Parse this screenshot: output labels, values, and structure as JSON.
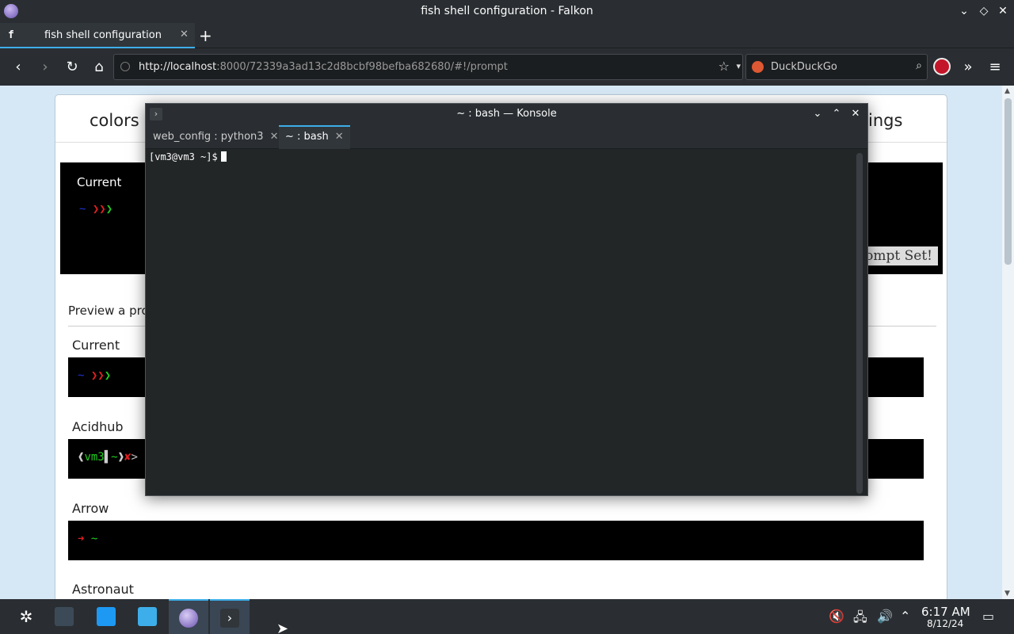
{
  "browser": {
    "window_title": "fish shell configuration - Falkon",
    "tab_favicon": "f",
    "tab_label": "fish shell configuration",
    "url_host": "http://localhost",
    "url_rest": ":8000/72339a3ad13c2d8bcbf98befba682680/#!/prompt",
    "search_engine": "DuckDuckGo"
  },
  "page": {
    "nav_tabs": [
      "colors",
      "ings"
    ],
    "current_label": "Current",
    "current_sample": "~ ❯❯❯",
    "set_button": "rompt Set!",
    "preview_label": "Preview a pro",
    "prompts": [
      {
        "name": "Current",
        "sample": "~ ❯❯❯"
      },
      {
        "name": "Acidhub",
        "sample": "❰vm3▌~❱✘>"
      },
      {
        "name": "Arrow",
        "sample": "➜  ~"
      },
      {
        "name": "Astronaut",
        "sample": ""
      }
    ]
  },
  "konsole": {
    "title": "~ : bash — Konsole",
    "tabs": [
      "web_config : python3",
      "~ : bash"
    ],
    "prompt_line": "[vm3@vm3 ~]$"
  },
  "taskbar": {
    "time": "6:17 AM",
    "date": "8/12/24"
  },
  "colors": {
    "accent": "#3daee9",
    "chrome": "#2a2e32"
  }
}
